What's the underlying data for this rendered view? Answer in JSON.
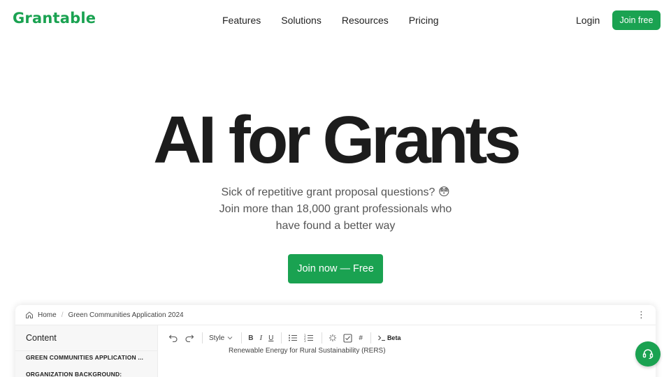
{
  "brand": {
    "logo": "Grantable",
    "accent": "#1aa251"
  },
  "nav": {
    "links": [
      "Features",
      "Solutions",
      "Resources",
      "Pricing"
    ],
    "login": "Login",
    "join_free": "Join free"
  },
  "hero": {
    "title": "AI for Grants",
    "subtitle_lines": [
      "Sick of repetitive grant proposal questions? 😳",
      "Join more than 18,000 grant professionals who",
      "have found a better way"
    ],
    "cta": "Join now — Free"
  },
  "app_preview": {
    "breadcrumb": {
      "home": "Home",
      "document": "Green Communities Application 2024"
    },
    "sidebar": {
      "title": "Content",
      "sections": [
        "GREEN COMMUNITIES APPLICATION ...",
        "ORGANIZATION BACKGROUND:"
      ]
    },
    "toolbar": {
      "style_label": "Style",
      "bold": "B",
      "italic": "I",
      "underline": "U",
      "hash": "#",
      "beta": "Beta"
    },
    "document_line": "Renewable Energy for Rural Sustainability (RERS)"
  },
  "icons": [
    "home-icon",
    "kebab-menu-icon",
    "undo-icon",
    "redo-icon",
    "chevron-down-icon",
    "bullet-list-icon",
    "numbered-list-icon",
    "magic-icon",
    "checkbox-icon",
    "hash-icon",
    "command-icon",
    "headset-icon"
  ]
}
